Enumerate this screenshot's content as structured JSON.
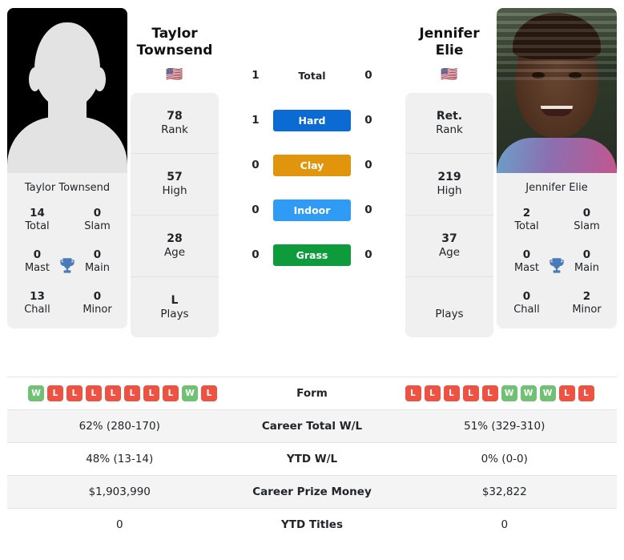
{
  "colors": {
    "hard": "#0b6bd3",
    "clay": "#e0950d",
    "indoor": "#2f9bf5",
    "grass": "#0d9b3c",
    "win": "#71c174",
    "loss": "#ee5242",
    "trophy": "#4a7ab8",
    "card_bg": "#f0f0f0"
  },
  "players": {
    "left": {
      "name": "Taylor Townsend",
      "display_name_line1": "Taylor",
      "display_name_line2": "Townsend",
      "flag": "🇺🇸",
      "flag_name": "United States",
      "photo_type": "placeholder-silhouette",
      "titles": [
        {
          "value": "14",
          "label": "Total"
        },
        {
          "value": "0",
          "label": "Slam"
        },
        {
          "value": "0",
          "label": "Mast"
        },
        {
          "value": "0",
          "label": "Main"
        },
        {
          "value": "13",
          "label": "Chall"
        },
        {
          "value": "0",
          "label": "Minor"
        }
      ],
      "ranking": [
        {
          "value": "78",
          "label": "Rank"
        },
        {
          "value": "57",
          "label": "High"
        },
        {
          "value": "28",
          "label": "Age"
        },
        {
          "value": "L",
          "label": "Plays"
        }
      ],
      "form": [
        "W",
        "L",
        "L",
        "L",
        "L",
        "L",
        "L",
        "L",
        "W",
        "L"
      ],
      "career_total_wl": "62% (280-170)",
      "ytd_wl": "48% (13-14)",
      "career_prize_money": "$1,903,990",
      "ytd_titles": "0"
    },
    "right": {
      "name": "Jennifer Elie",
      "display_name_line1": "Jennifer Elie",
      "display_name_line2": "",
      "flag": "🇺🇸",
      "flag_name": "United States",
      "photo_type": "portrait-photo",
      "titles": [
        {
          "value": "2",
          "label": "Total"
        },
        {
          "value": "0",
          "label": "Slam"
        },
        {
          "value": "0",
          "label": "Mast"
        },
        {
          "value": "0",
          "label": "Main"
        },
        {
          "value": "0",
          "label": "Chall"
        },
        {
          "value": "2",
          "label": "Minor"
        }
      ],
      "ranking": [
        {
          "value": "Ret.",
          "label": "Rank"
        },
        {
          "value": "219",
          "label": "High"
        },
        {
          "value": "37",
          "label": "Age"
        },
        {
          "value": "",
          "label": "Plays"
        }
      ],
      "form": [
        "L",
        "L",
        "L",
        "L",
        "L",
        "W",
        "W",
        "W",
        "L",
        "L"
      ],
      "career_total_wl": "51% (329-310)",
      "ytd_wl": "0% (0-0)",
      "career_prize_money": "$32,822",
      "ytd_titles": "0"
    }
  },
  "h2h": [
    {
      "label": "Total",
      "left": "1",
      "right": "0",
      "style": "plain"
    },
    {
      "label": "Hard",
      "left": "1",
      "right": "0",
      "style": "hard"
    },
    {
      "label": "Clay",
      "left": "0",
      "right": "0",
      "style": "clay"
    },
    {
      "label": "Indoor",
      "left": "0",
      "right": "0",
      "style": "indoor"
    },
    {
      "label": "Grass",
      "left": "0",
      "right": "0",
      "style": "grass"
    }
  ],
  "table": {
    "form_label": "Form",
    "rows": [
      {
        "label": "Career Total W/L",
        "left": "62% (280-170)",
        "right": "51% (329-310)",
        "shaded": true
      },
      {
        "label": "YTD W/L",
        "left": "48% (13-14)",
        "right": "0% (0-0)",
        "shaded": false
      },
      {
        "label": "Career Prize Money",
        "left": "$1,903,990",
        "right": "$32,822",
        "shaded": true
      },
      {
        "label": "YTD Titles",
        "left": "0",
        "right": "0",
        "shaded": false
      }
    ]
  }
}
